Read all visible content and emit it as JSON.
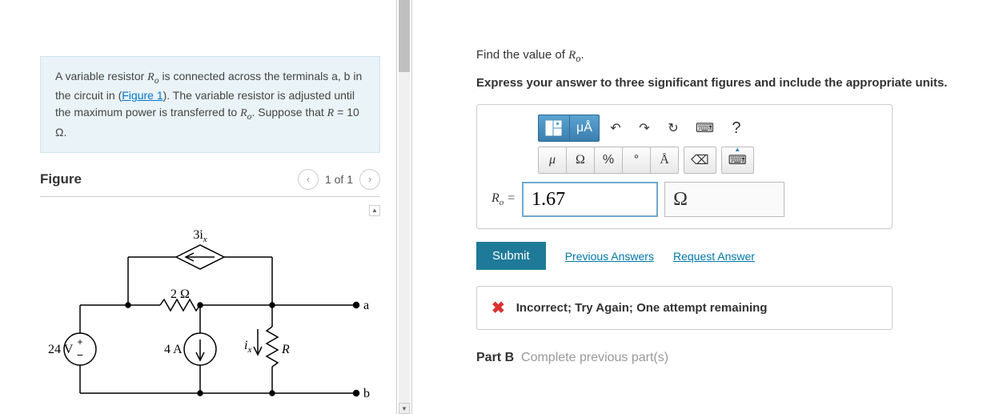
{
  "problem": {
    "text_before_link": "A variable resistor ",
    "var1_html": "R",
    "var1_sub": "o",
    "text_after_var1": " is connected across the terminals a, b in the circuit in (",
    "link_text": "Figure 1",
    "text_after_link": "). The variable resistor is adjusted until the maximum power is transferred to ",
    "var2_html": "R",
    "var2_sub": "o",
    "text_suppose": ". Suppose that ",
    "var3": "R",
    "eq_text": " = 10 Ω."
  },
  "figure": {
    "title": "Figure",
    "counter": "1 of 1",
    "labels": {
      "dep_src": "3i",
      "dep_sub": "x",
      "r2": "2 Ω",
      "vsrc": "24 V",
      "isrc": "4 A",
      "ix": "i",
      "ix_sub": "x",
      "R": "R",
      "node_a": "a",
      "node_b": "b"
    }
  },
  "question": {
    "prompt_prefix": "Find the value of ",
    "prompt_var": "R",
    "prompt_sub": "o",
    "prompt_suffix": ".",
    "instruction": "Express your answer to three significant figures and include the appropriate units."
  },
  "toolbar": {
    "templates_icon": "▦",
    "micro_a": "μÅ",
    "undo": "↶",
    "redo": "↷",
    "reset": "↻",
    "keyboard": "⌨",
    "help": "?",
    "mu": "μ",
    "omega": "Ω",
    "percent": "%",
    "degree": "°",
    "angstrom": "Å",
    "backspace": "⌫",
    "keyboard2": "⌨"
  },
  "answer": {
    "label_var": "R",
    "label_sub": "o",
    "equals": " = ",
    "value": "1.67",
    "unit": "Ω"
  },
  "actions": {
    "submit": "Submit",
    "previous": "Previous Answers",
    "request": "Request Answer"
  },
  "feedback": {
    "text": "Incorrect; Try Again; One attempt remaining"
  },
  "part_b": {
    "label": "Part B",
    "status": "Complete previous part(s)"
  }
}
